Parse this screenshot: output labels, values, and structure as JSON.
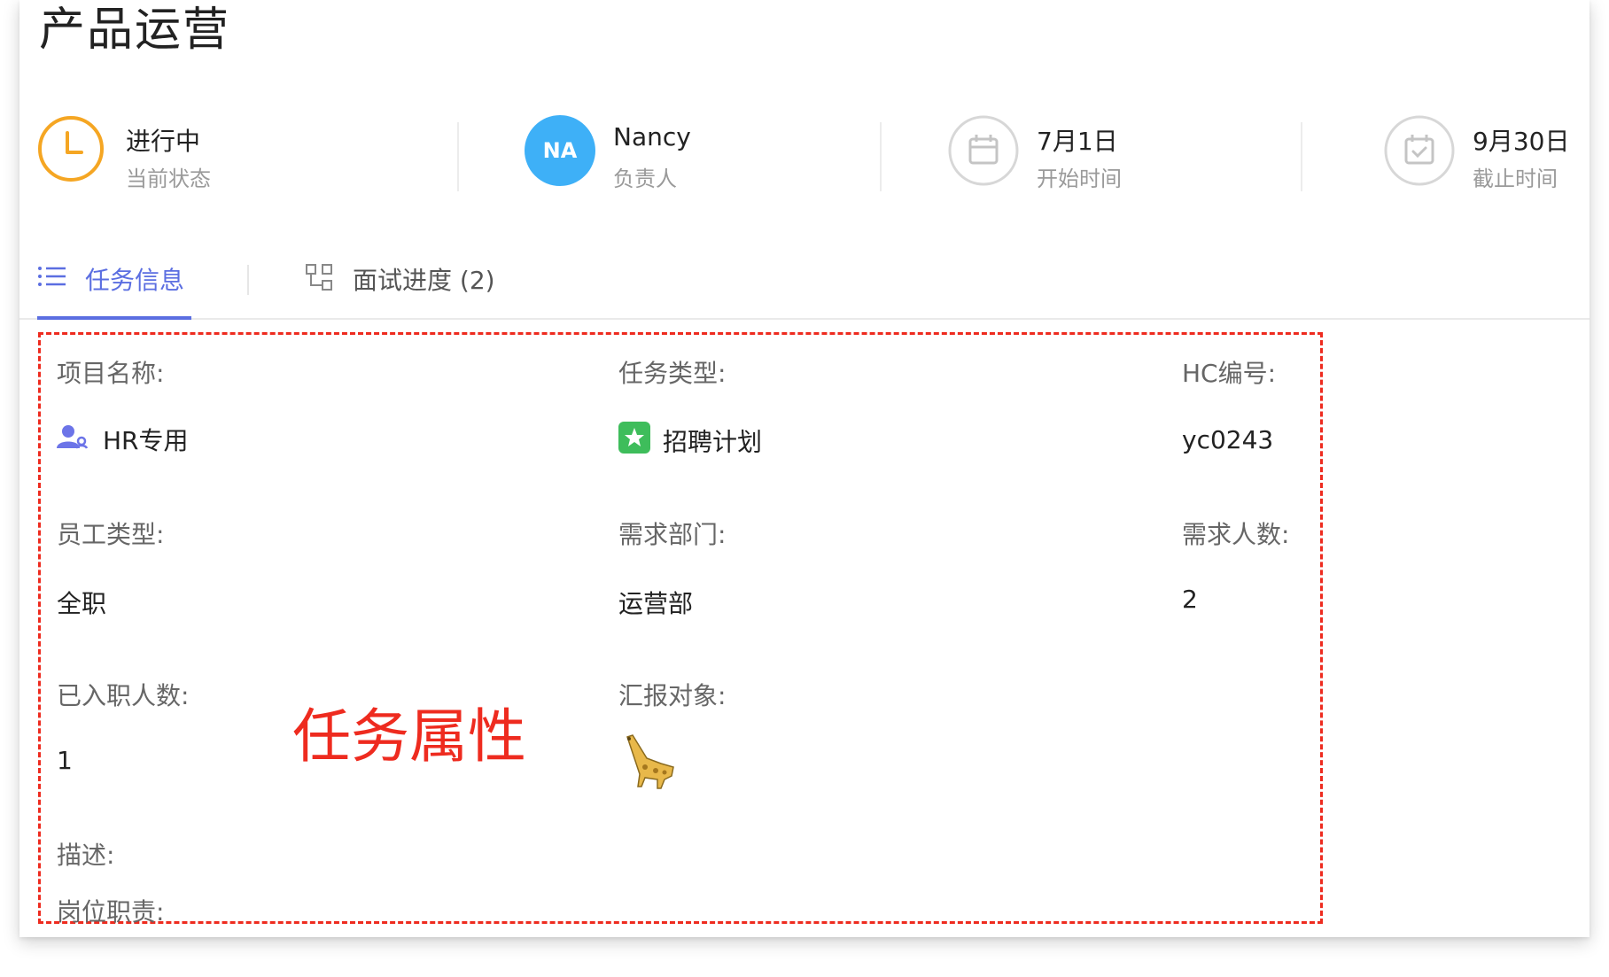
{
  "header": {
    "title": "产品运营"
  },
  "stats": [
    {
      "main": "进行中",
      "sub": "当前状态",
      "icon": "clock-icon",
      "color": "#f5a623"
    },
    {
      "main": "Nancy",
      "sub": "负责人",
      "avatar_initials": "NA",
      "color": "#3eb0f7"
    },
    {
      "main": "7月1日",
      "sub": "开始时间",
      "icon": "calendar-icon"
    },
    {
      "main": "9月30日",
      "sub": "截止时间",
      "icon": "calendar-check-icon"
    }
  ],
  "tabs": [
    {
      "label": "任务信息",
      "icon": "list-icon",
      "active": true
    },
    {
      "label": "面试进度 (2)",
      "icon": "flow-chart-icon",
      "active": false
    }
  ],
  "fields": {
    "project_name": {
      "label": "项目名称:",
      "value": "HR专用",
      "icon": "user-group-icon"
    },
    "task_type": {
      "label": "任务类型:",
      "value": "招聘计划",
      "icon": "star-badge-icon"
    },
    "hc_number": {
      "label": "HC编号:",
      "value": "yc0243"
    },
    "employee_type": {
      "label": "员工类型:",
      "value": "全职"
    },
    "department": {
      "label": "需求部门:",
      "value": "运营部"
    },
    "headcount": {
      "label": "需求人数:",
      "value": "2"
    },
    "onboarded": {
      "label": "已入职人数:",
      "value": "1"
    },
    "report_to": {
      "label": "汇报对象:",
      "avatar": "giraffe-avatar"
    },
    "description": {
      "label": "描述:"
    },
    "responsibilities": {
      "label": "岗位职责:"
    }
  },
  "annotation": {
    "text": "任务属性",
    "color": "#ee2b1f"
  }
}
